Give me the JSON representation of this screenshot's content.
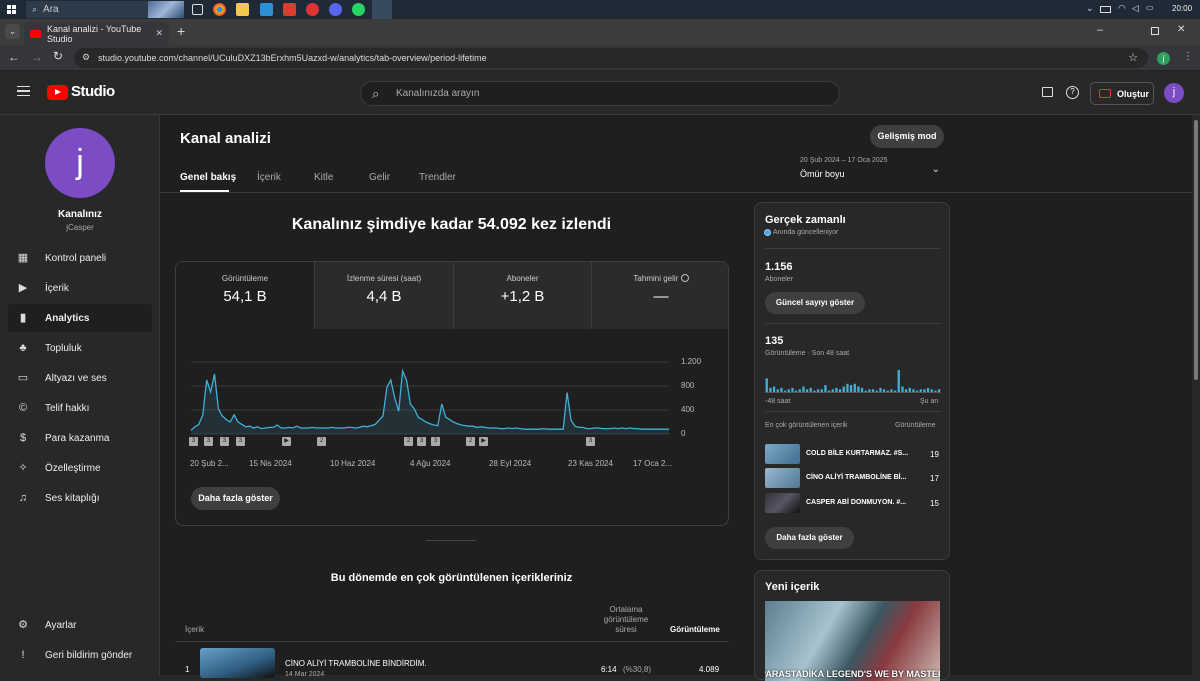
{
  "taskbar": {
    "search_placeholder": "Ara",
    "time": "20:00"
  },
  "browser": {
    "tab_title": "Kanal analizi - YouTube Studio",
    "url": "studio.youtube.com/channel/UCuluDXZ13bErxhm5Uazxd-w/analytics/tab-overview/period-lifetime",
    "profile_initial": "j"
  },
  "header": {
    "logo_text": "Studio",
    "search_placeholder": "Kanalınızda arayın",
    "create_label": "Oluştur",
    "avatar_initial": "j"
  },
  "sidebar": {
    "avatar_initial": "j",
    "channel_title": "Kanalınız",
    "channel_handle": "jCasper",
    "items": [
      {
        "label": "Kontrol paneli"
      },
      {
        "label": "İçerik"
      },
      {
        "label": "Analytics"
      },
      {
        "label": "Topluluk"
      },
      {
        "label": "Altyazı ve ses"
      },
      {
        "label": "Telif hakkı"
      },
      {
        "label": "Para kazanma"
      },
      {
        "label": "Özelleştirme"
      },
      {
        "label": "Ses kitaplığı"
      }
    ],
    "bottom": [
      {
        "label": "Ayarlar"
      },
      {
        "label": "Geri bildirim gönder"
      }
    ]
  },
  "main": {
    "title": "Kanal analizi",
    "advanced_label": "Gelişmiş mod",
    "tabs": [
      {
        "label": "Genel bakış"
      },
      {
        "label": "İçerik"
      },
      {
        "label": "Kitle"
      },
      {
        "label": "Gelir"
      },
      {
        "label": "Trendler"
      }
    ],
    "date_range": "20 Şub 2024 – 17 Oca 2025",
    "period": "Ömür boyu",
    "headline": "Kanalınız şimdiye kadar 54.092 kez izlendi",
    "metrics": [
      {
        "label": "Görüntüleme",
        "value": "54,1 B"
      },
      {
        "label": "İzlenme süresi (saat)",
        "value": "4,4 B"
      },
      {
        "label": "Aboneler",
        "value": "+1,2 B"
      },
      {
        "label": "Tahmini gelir",
        "value": "—"
      }
    ],
    "show_more": "Daha fazla göster",
    "top_content_title": "Bu dönemde en çok görüntülenen içerikleriniz",
    "table": {
      "col_content": "İçerik",
      "col_avg": "Ortalama görüntüleme süresi",
      "col_views": "Görüntüleme",
      "rows": [
        {
          "rank": "1",
          "title": "CİNO ALİYİ TRAMBOLİNE BİNDİRDİM.",
          "date": "14 Mar 2024",
          "avg": "6:14",
          "pct": "(%30,8)",
          "views": "4.089"
        }
      ]
    }
  },
  "chart_data": {
    "type": "line",
    "x_tick_labels": [
      "20 Şub 2...",
      "15 Nis 2024",
      "10 Haz 2024",
      "4 Ağu 2024",
      "28 Eyl 2024",
      "23 Kas 2024",
      "17 Oca 2..."
    ],
    "y_tick_labels": [
      "1.200",
      "800",
      "400",
      "0"
    ],
    "ylim": [
      0,
      1200
    ],
    "series": [
      {
        "values": [
          60,
          120,
          160,
          320,
          900,
          700,
          1000,
          420,
          300,
          240,
          200,
          320,
          200,
          160,
          120,
          130,
          100,
          120,
          90,
          100,
          110,
          110,
          150,
          100,
          100,
          110,
          100,
          130,
          100,
          100,
          100,
          110,
          100,
          100,
          100,
          100,
          110,
          100,
          100,
          100,
          110,
          110,
          100,
          110,
          130,
          120,
          140,
          160,
          230,
          300,
          780,
          900,
          600,
          380,
          1050,
          900,
          500,
          420,
          280,
          240,
          200,
          170,
          150,
          140,
          500,
          280,
          240,
          200,
          170,
          150,
          140,
          130,
          130,
          110,
          120,
          110,
          100,
          100,
          100,
          90,
          90,
          100,
          90,
          100,
          90,
          80,
          80,
          80,
          80,
          80,
          90,
          80,
          80,
          80,
          80,
          80,
          690,
          230,
          130,
          110,
          110,
          90,
          90,
          100,
          100,
          90,
          90,
          90,
          100,
          90,
          100,
          90,
          100,
          90,
          90,
          80,
          80,
          80,
          80,
          80,
          80,
          80,
          80
        ]
      }
    ],
    "event_markers": [
      "3",
      "3",
      "3",
      "3",
      "▶",
      "2",
      "2",
      "3",
      "3",
      "2",
      "▶",
      "3"
    ],
    "grid": true
  },
  "realtime": {
    "title": "Gerçek zamanlı",
    "subtitle": "Anında güncelleniyor",
    "subscribers_value": "1.156",
    "subscribers_label": "Aboneler",
    "live_count_btn": "Güncel sayıyı göster",
    "views_value": "135",
    "views_label": "Görüntüleme · Son 48 saat",
    "axis_left": "-48 saat",
    "axis_right": "Şu an",
    "bar_values": [
      10,
      3,
      4,
      2,
      3,
      1,
      2,
      3,
      1,
      2,
      4,
      2,
      3,
      1,
      2,
      2,
      5,
      1,
      2,
      3,
      2,
      4,
      6,
      5,
      6,
      4,
      3,
      1,
      2,
      2,
      1,
      3,
      2,
      1,
      2,
      1,
      16,
      4,
      2,
      3,
      2,
      1,
      2,
      2,
      3,
      2,
      1,
      2
    ],
    "top_content_label": "En çok görüntülenen içerik",
    "views_col_label": "Görüntüleme",
    "items": [
      {
        "title": "COLD BİLE KURTARMAZ. #S...",
        "views": "19"
      },
      {
        "title": "CİNO ALİYİ TRAMBOLİNE Bİ...",
        "views": "17"
      },
      {
        "title": "CASPER ABİ DONMUYON. #...",
        "views": "15"
      }
    ],
    "show_more": "Daha fazla göster"
  },
  "latest": {
    "title": "Yeni içerik",
    "thumb_text": "PARASTADİKA LEGEND'S WE BY MASTER"
  },
  "colors": {
    "accent": "#3ea6ff",
    "line": "#41b0d8",
    "brand": "#ff0000",
    "avatar": "#7b4cc4"
  }
}
